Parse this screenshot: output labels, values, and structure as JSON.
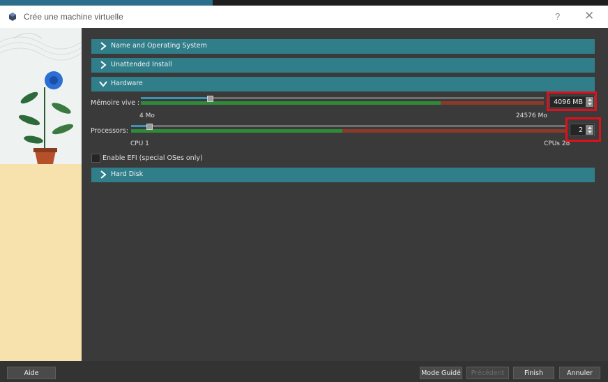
{
  "window": {
    "title": "Crée une machine virtuelle",
    "help": "?",
    "close": "✕"
  },
  "sections": {
    "name_os": "Name and Operating System",
    "unattended": "Unattended Install",
    "hardware": "Hardware",
    "hard_disk": "Hard Disk"
  },
  "hardware": {
    "memory": {
      "label": "Mémoire vive :",
      "min_label": "4 Mo",
      "max_label": "24576 Mo",
      "value": "4096 MB",
      "fraction": 0.167
    },
    "processors": {
      "label": "Processors:",
      "min_label": "CPU 1",
      "max_label": "CPUs 28",
      "value": "2",
      "fraction": 0.037
    },
    "efi": {
      "label": "Enable EFI (special OSes only)",
      "checked": false
    }
  },
  "buttons": {
    "help": "Aide",
    "guided": "Mode Guidé",
    "previous": "Précédent",
    "finish": "Finish",
    "cancel": "Annuler"
  },
  "colors": {
    "section_header": "#2f7e8a",
    "scale_green": "#2f8a3a",
    "scale_red": "#8a3a2a",
    "highlight": "#e0101a",
    "left_pane": "#f7e2ad"
  }
}
